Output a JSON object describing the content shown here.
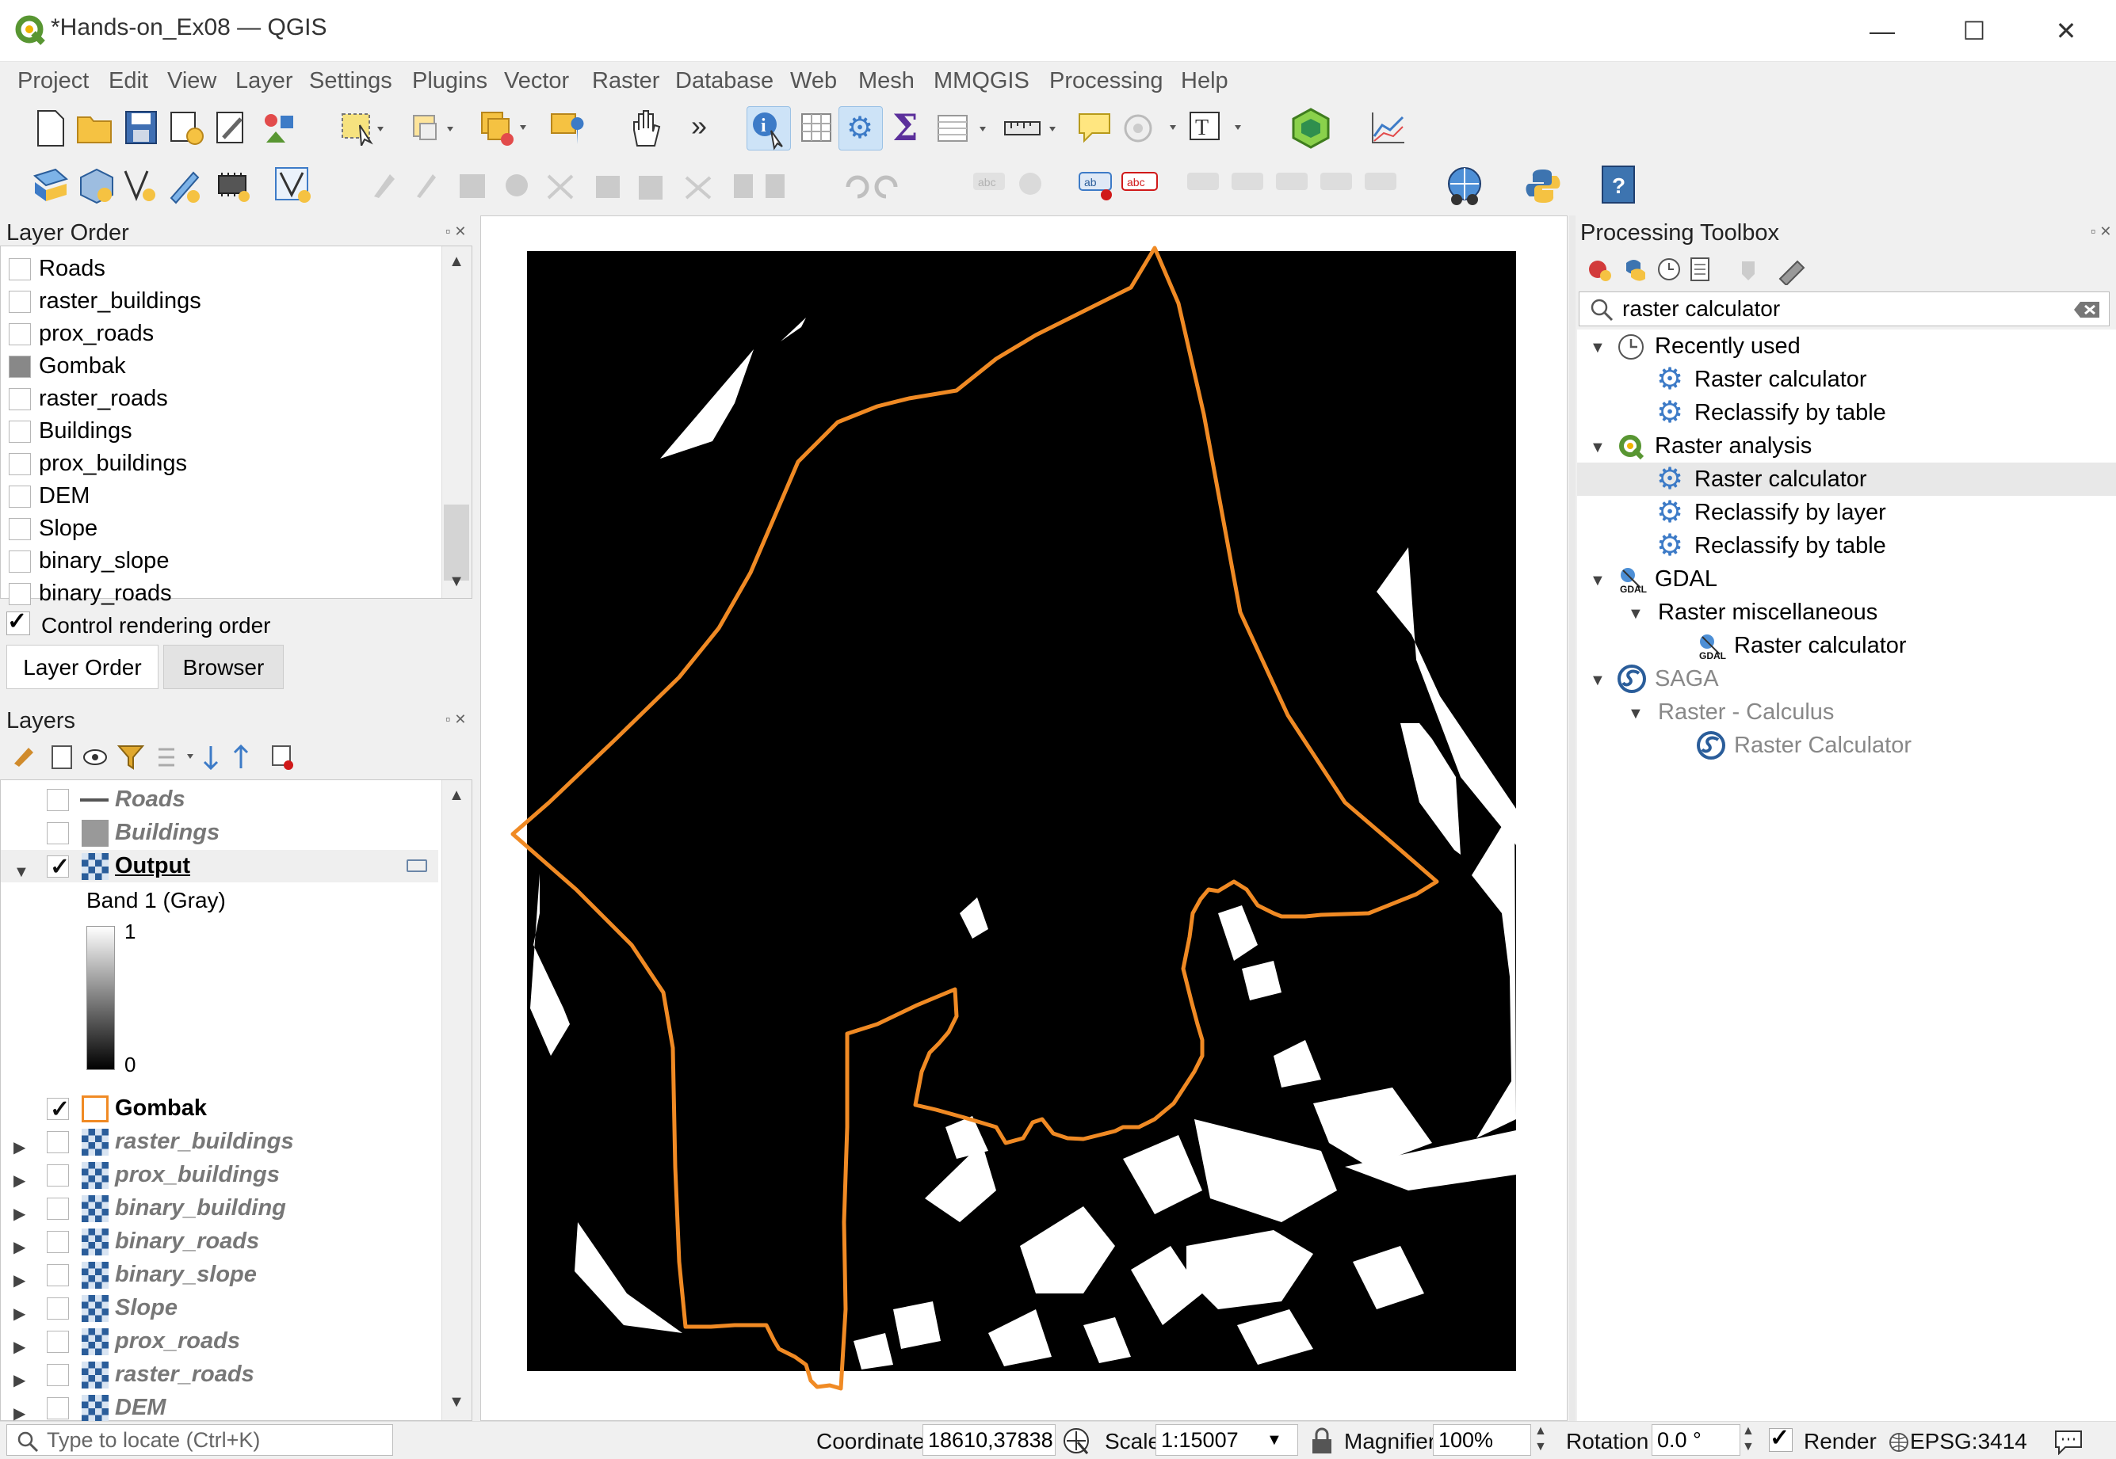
{
  "window": {
    "title": "*Hands-on_Ex08 — QGIS",
    "minimize": "—",
    "maximize": "☐",
    "close": "✕"
  },
  "menu": [
    "Project",
    "Edit",
    "View",
    "Layer",
    "Settings",
    "Plugins",
    "Vector",
    "Raster",
    "Database",
    "Web",
    "Mesh",
    "MMQGIS",
    "Processing",
    "Help"
  ],
  "layer_order": {
    "title": "Layer Order",
    "items": [
      "Roads",
      "raster_buildings",
      "prox_roads",
      "Gombak",
      "raster_roads",
      "Buildings",
      "prox_buildings",
      "DEM",
      "Slope",
      "binary_slope",
      "binary_roads"
    ],
    "control_label": "Control rendering order",
    "tabs": [
      "Layer Order",
      "Browser"
    ]
  },
  "layers": {
    "title": "Layers",
    "items": [
      {
        "name": "Roads",
        "checked": false,
        "type": "line"
      },
      {
        "name": "Buildings",
        "checked": false,
        "type": "polygon"
      },
      {
        "name": "Output",
        "checked": true,
        "type": "raster"
      },
      {
        "name": "Gombak",
        "checked": true,
        "type": "outline"
      },
      {
        "name": "raster_buildings",
        "checked": false,
        "type": "raster"
      },
      {
        "name": "prox_buildings",
        "checked": false,
        "type": "raster"
      },
      {
        "name": "binary_building",
        "checked": false,
        "type": "raster"
      },
      {
        "name": "binary_roads",
        "checked": false,
        "type": "raster"
      },
      {
        "name": "binary_slope",
        "checked": false,
        "type": "raster"
      },
      {
        "name": "Slope",
        "checked": false,
        "type": "raster"
      },
      {
        "name": "prox_roads",
        "checked": false,
        "type": "raster"
      },
      {
        "name": "raster_roads",
        "checked": false,
        "type": "raster"
      },
      {
        "name": "DEM",
        "checked": false,
        "type": "raster"
      }
    ],
    "band_label": "Band 1 (Gray)",
    "legend_max": "1",
    "legend_min": "0"
  },
  "toolbox": {
    "title": "Processing Toolbox",
    "search_value": "raster calculator",
    "recently_used": "Recently used",
    "recent_items": [
      "Raster calculator",
      "Reclassify by table"
    ],
    "raster_analysis": "Raster analysis",
    "raster_items": [
      "Raster calculator",
      "Reclassify by layer",
      "Reclassify by table"
    ],
    "gdal": "GDAL",
    "gdal_group": "Raster miscellaneous",
    "gdal_item": "Raster calculator",
    "saga": "SAGA",
    "saga_group": "Raster - Calculus",
    "saga_item": "Raster Calculator"
  },
  "status": {
    "locate_placeholder": "Type to locate (Ctrl+K)",
    "coordinate_label": "Coordinate",
    "coordinate_value": "18610,37838",
    "scale_label": "Scale",
    "scale_value": "1:15007",
    "magnifier_label": "Magnifier",
    "magnifier_value": "100%",
    "rotation_label": "Rotation",
    "rotation_value": "0.0 °",
    "render_label": "Render",
    "crs": "EPSG:3414"
  },
  "colors": {
    "accent": "#3d7bc7",
    "boundary": "#f08a24",
    "qgis_green": "#589632",
    "selected_row": "#e8e8e8"
  }
}
